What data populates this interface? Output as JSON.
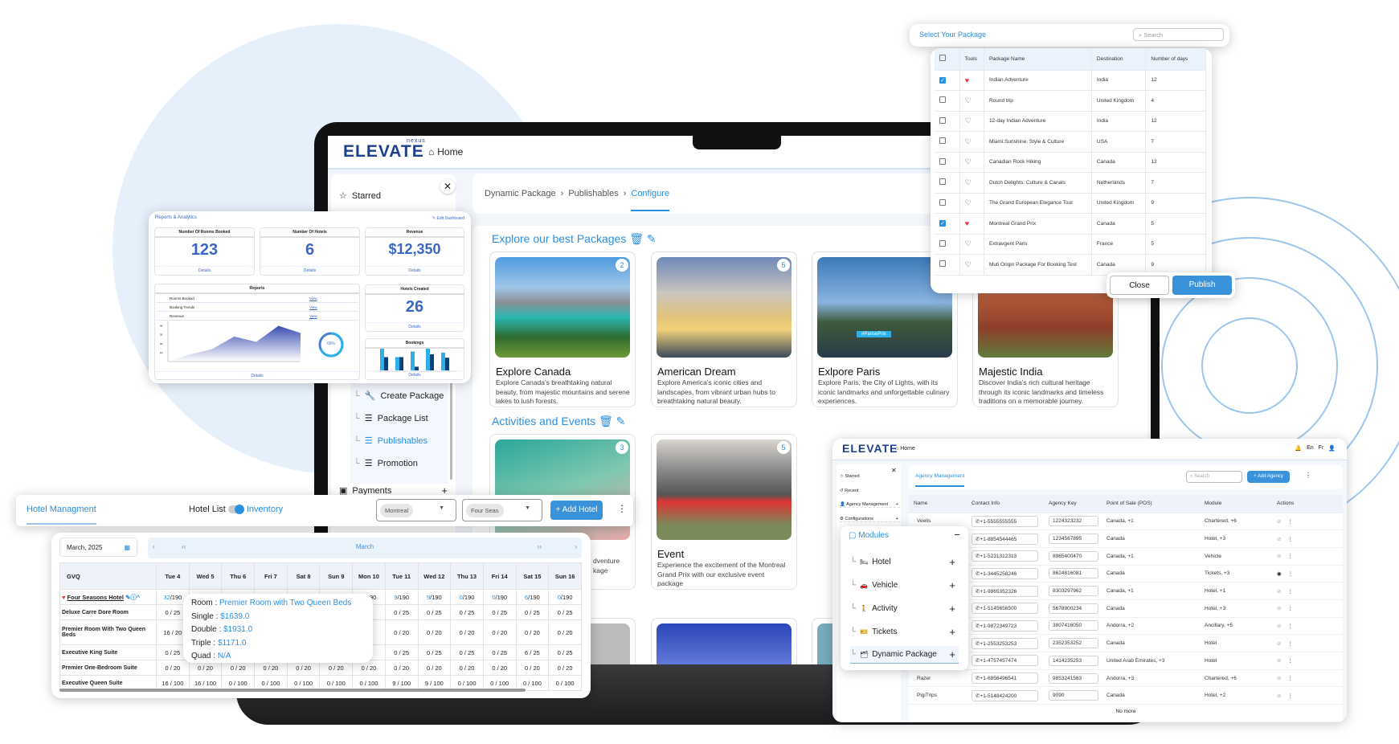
{
  "colors": {
    "accent": "#2b8fe0",
    "brand": "#1d3f8f",
    "heart": "#e53935"
  },
  "laptop": {
    "logo": "ELEVATE",
    "logo_sup": "nexus",
    "home": "Home",
    "sidebar": {
      "starred": "Starred",
      "items": [
        {
          "label": "Create Package",
          "icon": "wrench-icon"
        },
        {
          "label": "Package List",
          "icon": "list-icon"
        },
        {
          "label": "Publishables",
          "icon": "list-icon",
          "active": true
        },
        {
          "label": "Promotion",
          "icon": "list-icon"
        }
      ],
      "payments": "Payments"
    },
    "breadcrumb": [
      "Dynamic Package",
      "Publishables",
      "Configure"
    ],
    "section1": "Explore our best Packages",
    "section2": "Activities and Events",
    "packages": [
      {
        "title": "Explore Canada",
        "count": "2",
        "desc": "Explore Canada's breathtaking natural beauty, from majestic mountains and serene lakes to lush forests."
      },
      {
        "title": "American Dream",
        "count": "5",
        "desc": "Explore America's iconic cities and landscapes, from vibrant urban hubs to breathtaking natural beauty."
      },
      {
        "title": "Exlpore Paris",
        "count": "",
        "desc": "Explore Paris, the City of Lights, with its iconic landmarks and unforgettable culinary experiences.",
        "banner": "#ParisePrix"
      },
      {
        "title": "Majestic India",
        "count": "",
        "desc": "Discover India's rich cultural heritage through its iconic landmarks and timeless traditions on a memorable journey."
      }
    ],
    "activities": [
      {
        "title": "",
        "count": "3",
        "desc_fragments": [
          "dventure",
          "kage"
        ]
      },
      {
        "title": "Event",
        "count": "5",
        "desc": "Experience the excitement of the Montreal Grand Prix with our exclusive event package"
      }
    ]
  },
  "package_modal": {
    "title": "Select Your Package",
    "search_placeholder": "Search",
    "columns": [
      "",
      "Tools",
      "Package Name",
      "Destination",
      "Number of days"
    ],
    "rows": [
      {
        "checked": true,
        "fav": true,
        "name": "Indian Adventure",
        "dest": "India",
        "days": "12"
      },
      {
        "checked": false,
        "fav": false,
        "name": "Round trip",
        "dest": "United Kingdom",
        "days": "4"
      },
      {
        "checked": false,
        "fav": false,
        "name": "12-day Indian Adventure",
        "dest": "India",
        "days": "12"
      },
      {
        "checked": false,
        "fav": false,
        "name": "Miami:Sunshine, Style & Culture",
        "dest": "USA",
        "days": "7"
      },
      {
        "checked": false,
        "fav": false,
        "name": "Canadian Rock Hiking",
        "dest": "Canada",
        "days": "12"
      },
      {
        "checked": false,
        "fav": false,
        "name": "Dutch Delights: Culture & Canals",
        "dest": "Netherlands",
        "days": "7"
      },
      {
        "checked": false,
        "fav": false,
        "name": "The Grand European Elegance Tour",
        "dest": "United Kingdom",
        "days": "9"
      },
      {
        "checked": true,
        "fav": true,
        "name": "Montreal Grand Prix",
        "dest": "Canada",
        "days": "5"
      },
      {
        "checked": false,
        "fav": false,
        "name": "Extravgent Paris",
        "dest": "France",
        "days": "5"
      },
      {
        "checked": false,
        "fav": false,
        "name": "Muti Origin Package For Booking Test",
        "dest": "Canada",
        "days": "9"
      }
    ],
    "close": "Close",
    "publish": "Publish"
  },
  "reports": {
    "title": "Reports & Analytics",
    "edit": "Edit Dashboard",
    "stats": [
      {
        "label": "Number Of Rooms Booked",
        "value": "123",
        "link": "Details"
      },
      {
        "label": "Number Of Hotels",
        "value": "6",
        "link": "Details"
      },
      {
        "label": "Revenue",
        "value": "$12,350",
        "link": "Details"
      }
    ],
    "reports_title": "Reports",
    "report_items": [
      {
        "label": "Rooms Booked",
        "link": "View"
      },
      {
        "label": "Booking Trends",
        "link": "View"
      },
      {
        "label": "Revenue",
        "link": "View"
      }
    ],
    "area_chart": {
      "yticks": [
        "10",
        "20",
        "30",
        "40"
      ],
      "values": [
        0,
        8,
        14,
        28,
        22,
        40,
        32
      ]
    },
    "donut": {
      "label": "68%",
      "value": 68
    },
    "details": "Details",
    "hotels_created": {
      "label": "Hotels Created",
      "value": "26",
      "link": "Details"
    },
    "bookings": {
      "label": "Bookings",
      "pairs": [
        [
          40,
          25
        ],
        [
          25,
          25
        ],
        [
          35,
          8
        ],
        [
          40,
          30
        ],
        [
          33,
          24
        ]
      ],
      "link": "Details"
    }
  },
  "hotel_bar": {
    "title": "Hotel Managment",
    "toggle_left": "Hotel List",
    "toggle_right": "Inventory",
    "city": "Montreal",
    "hotel": "Four Seas",
    "add": "+ Add Hotel"
  },
  "inventory": {
    "date": "March, 2025",
    "month": "March",
    "prev": "‹",
    "prev2": "‹‹",
    "next2": "››",
    "next": "›",
    "columns": [
      "GVQ",
      "Tue 4",
      "Wed 5",
      "Thu 6",
      "Fri 7",
      "Sat 8",
      "Sun 9",
      "Mon 10",
      "Tue 11",
      "Wed 12",
      "Thu 13",
      "Fri 14",
      "Sat 15",
      "Sun 16"
    ],
    "hotel_row": {
      "name": "Four Seasons Hotel",
      "cells": [
        [
          "32",
          "/190"
        ],
        [
          "",
          ""
        ],
        [
          "",
          ""
        ],
        [
          "",
          ""
        ],
        [
          "",
          ""
        ],
        [
          "",
          ""
        ],
        [
          "",
          "0/190"
        ],
        [
          "9",
          "/190"
        ],
        [
          "9",
          "/190"
        ],
        [
          "0",
          "/190"
        ],
        [
          "0",
          "/190"
        ],
        [
          "6",
          "/190"
        ],
        [
          "0",
          "/190"
        ]
      ]
    },
    "rows": [
      {
        "name": "Deluxe Carre Dore Room",
        "cells": [
          "0 / 25",
          "",
          "",
          "",
          "",
          "",
          "",
          "0 / 25",
          "0 / 25",
          "0 / 25",
          "0 / 25",
          "0 / 25",
          "0 / 25"
        ]
      },
      {
        "name": "Premier Room With Two Queen Beds",
        "cells": [
          "16 / 20",
          "",
          "",
          "",
          "",
          "",
          "",
          "0 / 20",
          "0 / 20",
          "0 / 20",
          "0 / 20",
          "0 / 20",
          "0 / 20"
        ]
      },
      {
        "name": "Executive King Suite",
        "cells": [
          "0 / 25",
          "",
          "",
          "",
          "",
          "",
          "",
          "0 / 25",
          "0 / 25",
          "0 / 25",
          "0 / 25",
          "6 / 25",
          "0 / 25"
        ]
      },
      {
        "name": "Premier One-Bedroom Suite",
        "cells": [
          "0 / 20",
          "0 / 20",
          "0 / 20",
          "0 / 20",
          "0 / 20",
          "0 / 20",
          "0 / 20",
          "0 / 20",
          "0 / 20",
          "0 / 20",
          "0 / 20",
          "0 / 20",
          "0 / 20"
        ]
      },
      {
        "name": "Executive Queen Suite",
        "cells": [
          "16 / 100",
          "16 / 100",
          "0 / 100",
          "0 / 100",
          "0 / 100",
          "0 / 100",
          "0 / 100",
          "9 / 100",
          "9 / 100",
          "0 / 100",
          "0 / 100",
          "0 / 100",
          "0 / 100"
        ]
      }
    ],
    "tooltip": {
      "room_label": "Room : ",
      "room": "Premier Room with Two Queen Beds",
      "single_label": "Single : ",
      "single": "$1639.0",
      "double_label": "Double : ",
      "double": "$1931.0",
      "triple_label": "Triple : ",
      "triple": "$1171.0",
      "quad_label": "Quad : ",
      "quad": "N/A"
    }
  },
  "agency": {
    "logo": "ELEVATE",
    "home": "Home",
    "lang_en": "En",
    "lang_fr": "Fr",
    "sidebar": [
      "Starred",
      "Recent",
      "Agency Management",
      "Configurations"
    ],
    "tab": "Agency Management",
    "search_placeholder": "Search",
    "add": "+ Add Agency",
    "columns": [
      "Name",
      "Contact Info",
      "Agency Key",
      "Point of Sale (POS)",
      "Module",
      "Actions"
    ],
    "rows": [
      {
        "name": "Veelis",
        "phone": "+1-5555555555",
        "key": "1224323232",
        "pos": "Canada, +1",
        "module": "Chartered, +6",
        "visible": false
      },
      {
        "name": "",
        "phone": "+1-8854544465",
        "key": "1234567895",
        "pos": "Canada",
        "module": "Hotel, +3",
        "visible": false
      },
      {
        "name": "",
        "phone": "+1-5231312313",
        "key": "8965400470",
        "pos": "Canada, +1",
        "module": "Vehicle",
        "visible": false
      },
      {
        "name": "",
        "phone": "+1-3445258246",
        "key": "8624816081",
        "pos": "Canada",
        "module": "Tickets, +3",
        "visible": true
      },
      {
        "name": "",
        "phone": "+1-9865352326",
        "key": "8303297962",
        "pos": "Canada, +1",
        "module": "Hotel, +1",
        "visible": false
      },
      {
        "name": "",
        "phone": "+1-5145656500",
        "key": "5678900234",
        "pos": "Canada",
        "module": "Hotel, +3",
        "visible": false
      },
      {
        "name": "",
        "phone": "+1-9872349723",
        "key": "3807416050",
        "pos": "Andorra, +2",
        "module": "Ancillary, +5",
        "visible": false
      },
      {
        "name": "",
        "phone": "+1-2553253253",
        "key": "2352353252",
        "pos": "Canada",
        "module": "Hotel",
        "visible": false
      },
      {
        "name": "",
        "phone": "+1-4757457474",
        "key": "1414235253",
        "pos": "United Arab Emirates, +3",
        "module": "Hotel",
        "visible": false
      },
      {
        "name": "Razer",
        "phone": "+1-6856496541",
        "key": "9853241563",
        "pos": "Andorra, +3",
        "module": "Chartered, +6",
        "visible": false
      },
      {
        "name": "PigiTrips",
        "phone": "+1-5148424200",
        "key": "9090",
        "pos": "Canada",
        "module": "Hotel, +2",
        "visible": false
      }
    ],
    "footer": "No more",
    "modules": {
      "title": "Modules",
      "items": [
        "Hotel",
        "Vehicle",
        "Activity",
        "Tickets",
        "Dynamic Package"
      ]
    }
  }
}
